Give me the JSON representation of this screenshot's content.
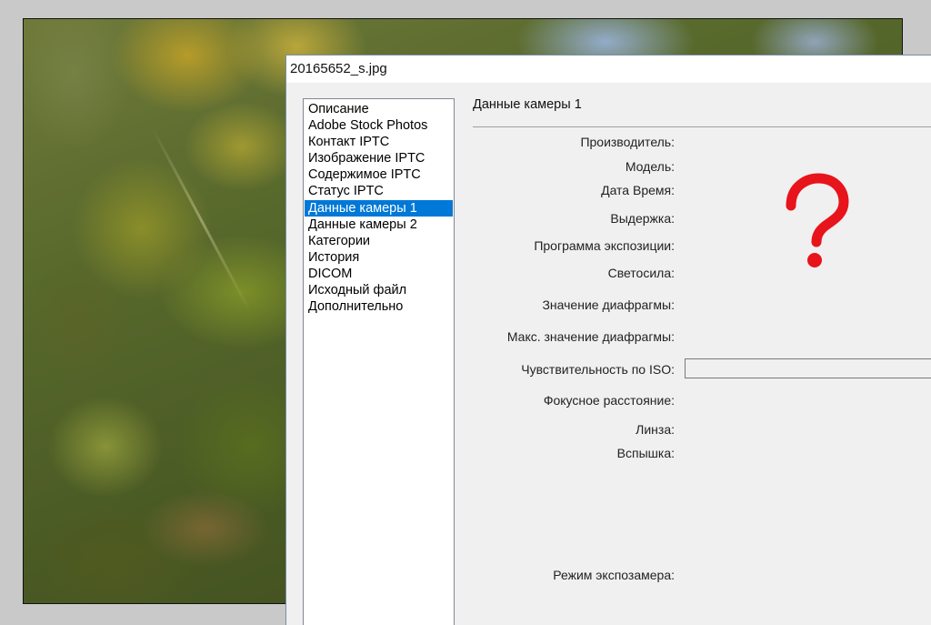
{
  "window": {
    "title": "20165652_s.jpg"
  },
  "sidebar": {
    "items": [
      {
        "label": "Описание",
        "selected": false
      },
      {
        "label": "Adobe Stock Photos",
        "selected": false
      },
      {
        "label": "Контакт IPTC",
        "selected": false
      },
      {
        "label": "Изображение IPTC",
        "selected": false
      },
      {
        "label": "Содержимое IPTC",
        "selected": false
      },
      {
        "label": "Статус IPTC",
        "selected": false
      },
      {
        "label": "Данные камеры 1",
        "selected": true
      },
      {
        "label": "Данные камеры 2",
        "selected": false
      },
      {
        "label": "Категории",
        "selected": false
      },
      {
        "label": "История",
        "selected": false
      },
      {
        "label": "DICOM",
        "selected": false
      },
      {
        "label": "Исходный файл",
        "selected": false
      },
      {
        "label": "Дополнительно",
        "selected": false
      }
    ]
  },
  "panel": {
    "title": "Данные камеры 1",
    "fields": {
      "manufacturer": "Производитель:",
      "model": "Модель:",
      "datetime": "Дата Время:",
      "exposure": "Выдержка:",
      "exposure_program": "Программа экспозиции:",
      "aperture": "Светосила:",
      "aperture_value": "Значение диафрагмы:",
      "max_aperture": "Макс. значение диафрагмы:",
      "iso": "Чувствительность по ISO:",
      "focal_length": "Фокусное расстояние:",
      "lens": "Линза:",
      "flash": "Вспышка:",
      "metering_mode": "Режим экспозамера:"
    },
    "iso_value": ""
  },
  "annotation": {
    "icon": "question-mark-icon",
    "color": "#e8141b"
  }
}
